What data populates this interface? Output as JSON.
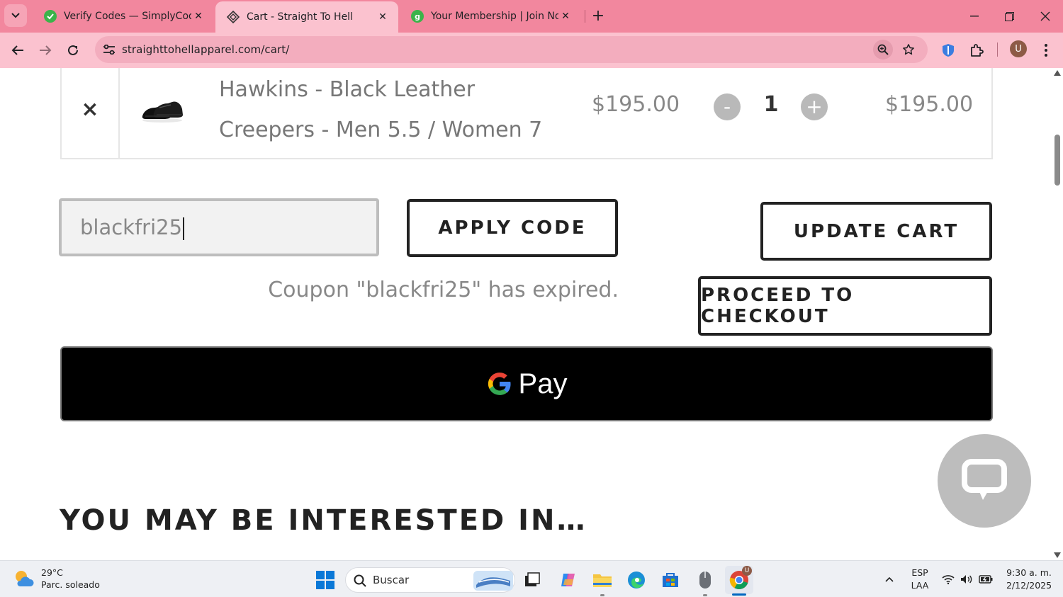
{
  "browser": {
    "tabs": [
      {
        "title": "Verify Codes — SimplyCodes",
        "active": false
      },
      {
        "title": "Cart - Straight To Hell",
        "active": true
      },
      {
        "title": "Your Membership | Join Now | T",
        "active": false
      }
    ],
    "url": "straighttohellapparel.com/cart/",
    "profile_initial": "U",
    "accent_color": "#f2879e"
  },
  "cart": {
    "item": {
      "name": "Hawkins - Black Leather Creepers - Men 5.5 / Women 7",
      "price": "$195.00",
      "quantity": "1",
      "subtotal": "$195.00",
      "remove_symbol": "×",
      "decrement_symbol": "-",
      "increment_symbol": "+"
    },
    "coupon": {
      "value": "blackfri25",
      "apply_label": "APPLY CODE",
      "message": "Coupon \"blackfri25\" has expired."
    },
    "update_label": "UPDATE CART",
    "checkout_label": "PROCEED TO CHECKOUT",
    "gpay_label": "Pay"
  },
  "section": {
    "title": "YOU MAY BE INTERESTED IN…"
  },
  "taskbar": {
    "weather_temp": "29°C",
    "weather_desc": "Parc. soleado",
    "search_placeholder": "Buscar",
    "lang_line1": "ESP",
    "lang_line2": "LAA",
    "time": "9:30 a. m.",
    "date": "2/12/2025",
    "chrome_badge": "U"
  }
}
